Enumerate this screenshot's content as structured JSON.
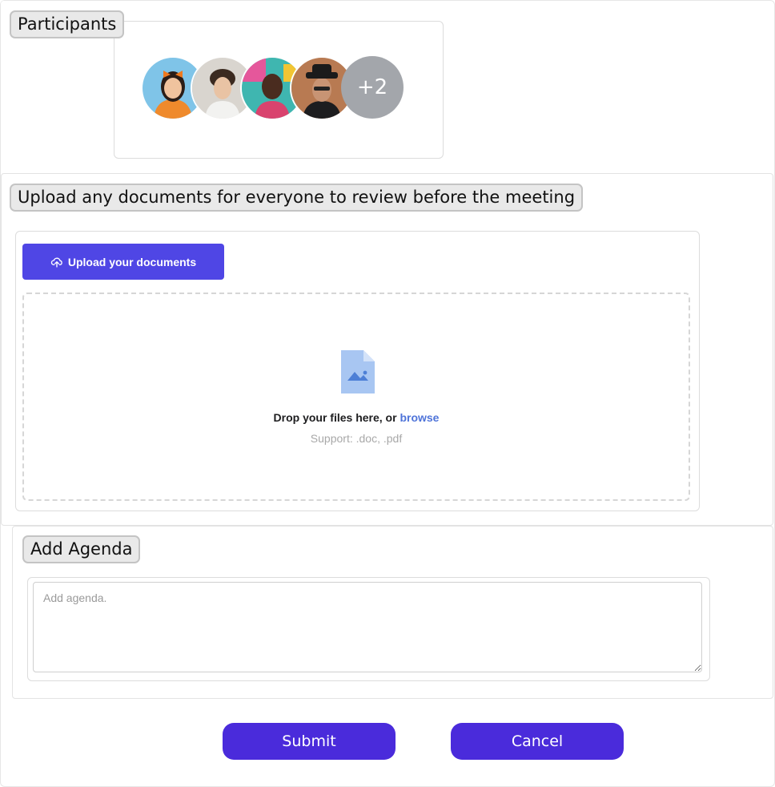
{
  "participants": {
    "heading": "Participants",
    "avatars": [
      {
        "name": "participant-1",
        "bg": "#7fc4e8"
      },
      {
        "name": "participant-2",
        "bg": "#d9d5cf"
      },
      {
        "name": "participant-3",
        "bg": "#3fb6b0"
      },
      {
        "name": "participant-4",
        "bg": "#b87a52"
      }
    ],
    "overflow_count": "+2"
  },
  "documents": {
    "heading": "Upload any documents for everyone to review before the meeting",
    "upload_button_label": "Upload your documents",
    "upload_icon": "cloud-upload-icon",
    "file_icon": "image-file-icon",
    "drop_text": "Drop your files here, or",
    "browse_link": "browse",
    "support_text": "Support: .doc, .pdf"
  },
  "agenda": {
    "heading": "Add Agenda",
    "placeholder": "Add agenda.",
    "value": ""
  },
  "actions": {
    "submit_label": "Submit",
    "cancel_label": "Cancel"
  },
  "colors": {
    "upload_button": "#4f46e5",
    "action_button": "#4a2bdb",
    "browse_link": "#4f74d9",
    "overflow_avatar": "#a3a6ab"
  }
}
